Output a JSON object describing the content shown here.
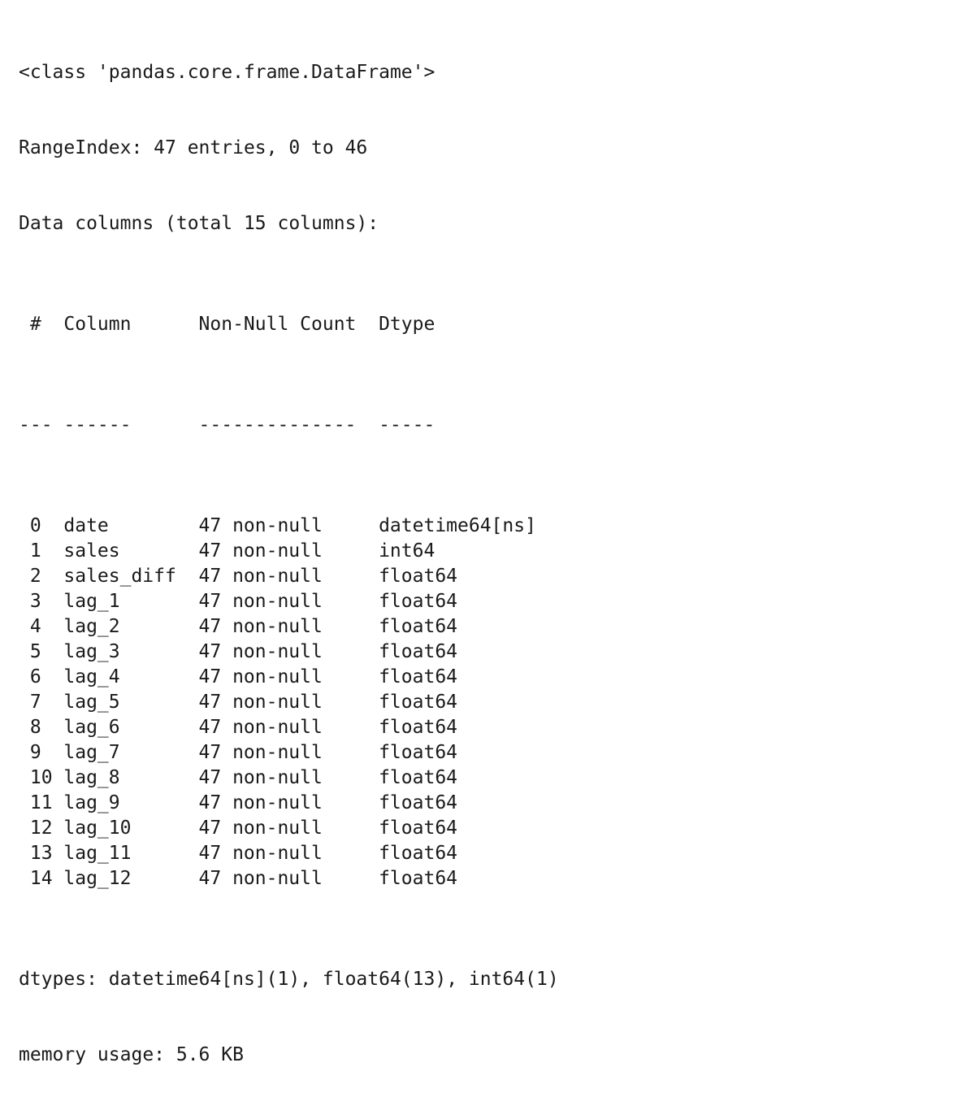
{
  "info": {
    "class_line": "<class 'pandas.core.frame.DataFrame'>",
    "range_index": "RangeIndex: 47 entries, 0 to 46",
    "data_columns": "Data columns (total 15 columns):",
    "headers": {
      "idx": " #",
      "column": "Column",
      "count": "Non-Null Count",
      "dtype": "Dtype"
    },
    "separators": {
      "idx": "---",
      "column": "------",
      "count": "--------------",
      "dtype": "-----"
    },
    "rows": [
      {
        "idx": " 0",
        "column": "date",
        "count": "47 non-null",
        "dtype": "datetime64[ns]"
      },
      {
        "idx": " 1",
        "column": "sales",
        "count": "47 non-null",
        "dtype": "int64"
      },
      {
        "idx": " 2",
        "column": "sales_diff",
        "count": "47 non-null",
        "dtype": "float64"
      },
      {
        "idx": " 3",
        "column": "lag_1",
        "count": "47 non-null",
        "dtype": "float64"
      },
      {
        "idx": " 4",
        "column": "lag_2",
        "count": "47 non-null",
        "dtype": "float64"
      },
      {
        "idx": " 5",
        "column": "lag_3",
        "count": "47 non-null",
        "dtype": "float64"
      },
      {
        "idx": " 6",
        "column": "lag_4",
        "count": "47 non-null",
        "dtype": "float64"
      },
      {
        "idx": " 7",
        "column": "lag_5",
        "count": "47 non-null",
        "dtype": "float64"
      },
      {
        "idx": " 8",
        "column": "lag_6",
        "count": "47 non-null",
        "dtype": "float64"
      },
      {
        "idx": " 9",
        "column": "lag_7",
        "count": "47 non-null",
        "dtype": "float64"
      },
      {
        "idx": " 10",
        "column": "lag_8",
        "count": "47 non-null",
        "dtype": "float64"
      },
      {
        "idx": " 11",
        "column": "lag_9",
        "count": "47 non-null",
        "dtype": "float64"
      },
      {
        "idx": " 12",
        "column": "lag_10",
        "count": "47 non-null",
        "dtype": "float64"
      },
      {
        "idx": " 13",
        "column": "lag_11",
        "count": "47 non-null",
        "dtype": "float64"
      },
      {
        "idx": " 14",
        "column": "lag_12",
        "count": "47 non-null",
        "dtype": "float64"
      }
    ],
    "dtypes_line": "dtypes: datetime64[ns](1), float64(13), int64(1)",
    "memory_line": "memory usage: 5.6 KB"
  }
}
